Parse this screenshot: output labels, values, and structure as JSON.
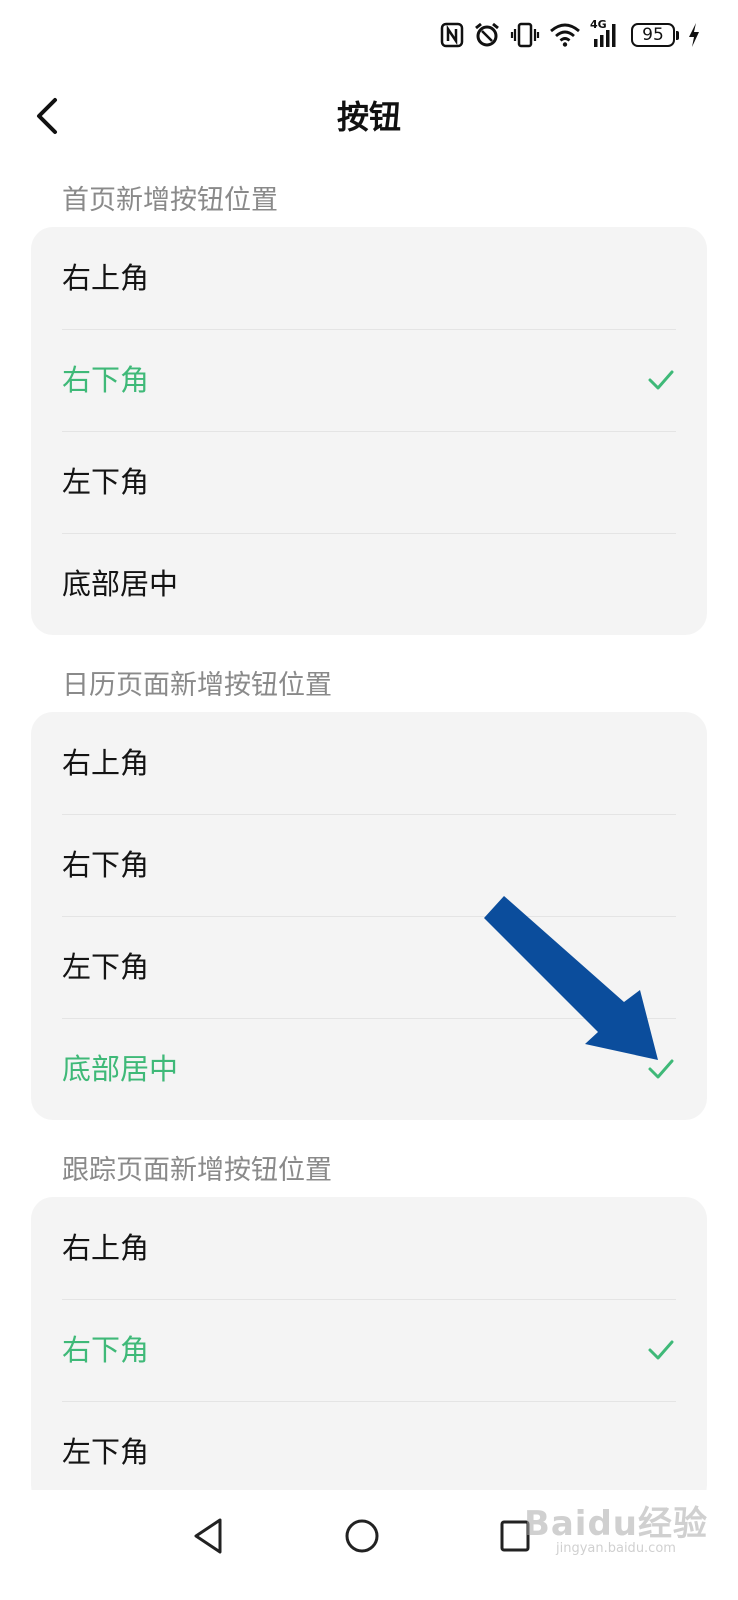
{
  "status_bar": {
    "battery_level": "95",
    "network_label": "4G"
  },
  "header": {
    "title": "按钮"
  },
  "sections": [
    {
      "label": "首页新增按钮位置",
      "options": [
        {
          "label": "右上角",
          "selected": false
        },
        {
          "label": "右下角",
          "selected": true
        },
        {
          "label": "左下角",
          "selected": false
        },
        {
          "label": "底部居中",
          "selected": false
        }
      ]
    },
    {
      "label": "日历页面新增按钮位置",
      "options": [
        {
          "label": "右上角",
          "selected": false
        },
        {
          "label": "右下角",
          "selected": false
        },
        {
          "label": "左下角",
          "selected": false
        },
        {
          "label": "底部居中",
          "selected": true
        }
      ]
    },
    {
      "label": "跟踪页面新增按钮位置",
      "options": [
        {
          "label": "右上角",
          "selected": false
        },
        {
          "label": "右下角",
          "selected": true
        },
        {
          "label": "左下角",
          "selected": false
        }
      ]
    }
  ],
  "colors": {
    "accent": "#3fb978",
    "annotation_arrow": "#0b4d9c",
    "card_background": "#f4f4f4"
  },
  "icons": {
    "back": "chevron-left-icon",
    "check": "check-icon",
    "nav_back": "triangle-back-icon",
    "nav_home": "circle-home-icon",
    "nav_recents": "square-recents-icon"
  },
  "watermark": {
    "brand": "Baidu经验",
    "url": "jingyan.baidu.com"
  }
}
